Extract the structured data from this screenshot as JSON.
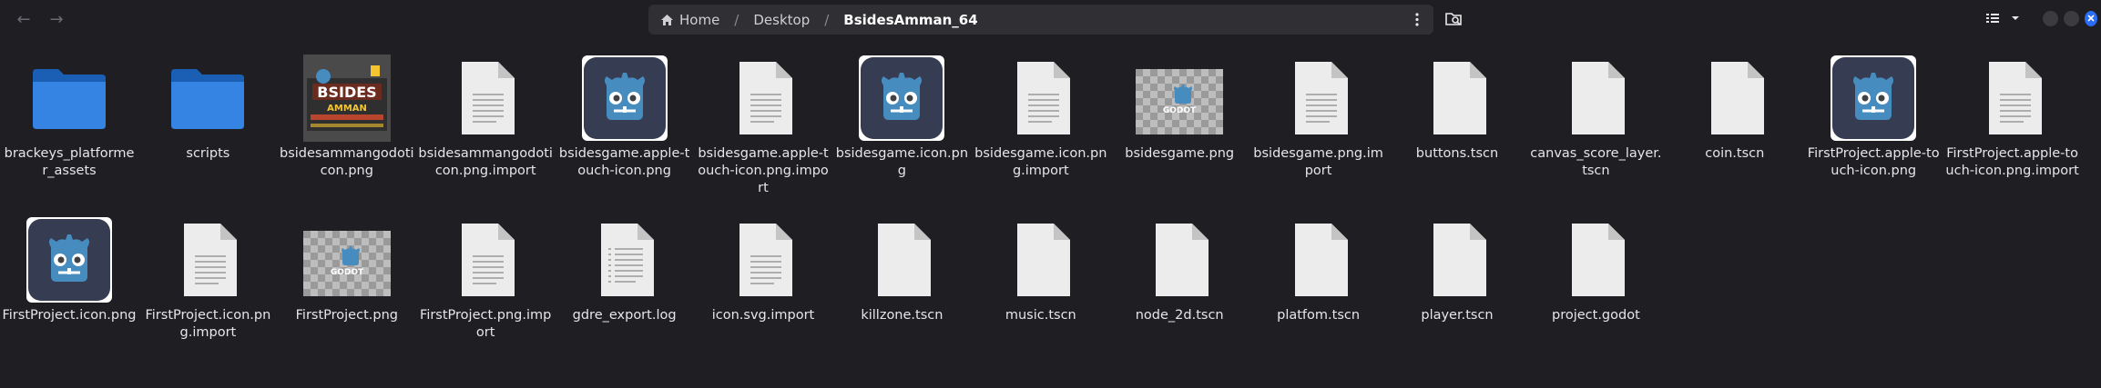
{
  "path": {
    "segments": [
      "Home",
      "Desktop",
      "BsidesAmman_64"
    ]
  },
  "files": [
    {
      "name": "brackeys_platformer_assets",
      "icon": "folder-icon"
    },
    {
      "name": "scripts",
      "icon": "folder-icon"
    },
    {
      "name": "bsidesammangodoticon.png",
      "icon": "bsides-image-icon"
    },
    {
      "name": "bsidesammangodoticon.png.import",
      "icon": "text-file-icon"
    },
    {
      "name": "bsidesgame.apple-touch-icon.png",
      "icon": "godot-image-icon"
    },
    {
      "name": "bsidesgame.apple-touch-icon.png.import",
      "icon": "text-file-icon"
    },
    {
      "name": "bsidesgame.icon.png",
      "icon": "godot-image-icon"
    },
    {
      "name": "bsidesgame.icon.png.import",
      "icon": "text-file-icon"
    },
    {
      "name": "bsidesgame.png",
      "icon": "godot-splash-image-icon"
    },
    {
      "name": "bsidesgame.png.import",
      "icon": "text-file-icon"
    },
    {
      "name": "buttons.tscn",
      "icon": "blank-file-icon"
    },
    {
      "name": "canvas_score_layer.tscn",
      "icon": "blank-file-icon"
    },
    {
      "name": "coin.tscn",
      "icon": "blank-file-icon"
    },
    {
      "name": "FirstProject.apple-touch-icon.png",
      "icon": "godot-image-icon"
    },
    {
      "name": "FirstProject.apple-touch-icon.png.import",
      "icon": "text-file-icon"
    },
    {
      "name": "FirstProject.icon.png",
      "icon": "godot-image-icon"
    },
    {
      "name": "FirstProject.icon.png.import",
      "icon": "text-file-icon"
    },
    {
      "name": "FirstProject.png",
      "icon": "godot-splash-image-icon"
    },
    {
      "name": "FirstProject.png.import",
      "icon": "text-file-icon"
    },
    {
      "name": "gdre_export.log",
      "icon": "log-file-icon"
    },
    {
      "name": "icon.svg.import",
      "icon": "text-file-icon"
    },
    {
      "name": "killzone.tscn",
      "icon": "blank-file-icon"
    },
    {
      "name": "music.tscn",
      "icon": "blank-file-icon"
    },
    {
      "name": "node_2d.tscn",
      "icon": "blank-file-icon"
    },
    {
      "name": "platfom.tscn",
      "icon": "blank-file-icon"
    },
    {
      "name": "player.tscn",
      "icon": "blank-file-icon"
    },
    {
      "name": "project.godot",
      "icon": "blank-file-icon"
    }
  ],
  "thumbnails": {
    "bsides_logo_text": "BSIDES",
    "bsides_logo_subtext": "AMMAN",
    "godot_text": "GODOT"
  },
  "colors": {
    "background": "#1f1f23",
    "folder": "#3584e4",
    "godot_blue": "#478cbf",
    "window_close": "#2a6df4"
  }
}
